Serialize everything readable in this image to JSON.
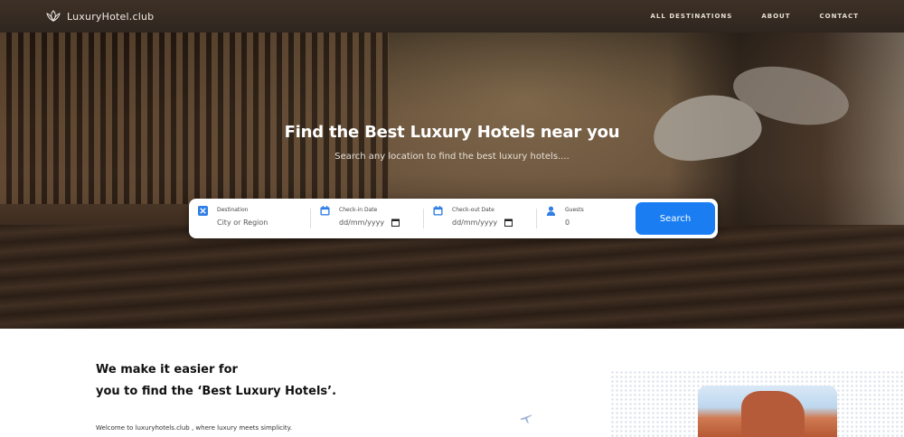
{
  "nav": {
    "logo_text": "LuxuryHotel.club",
    "logo_icon": "lotus-icon",
    "links": [
      "ALL DESTINATIONS",
      "ABOUT",
      "CONTACT"
    ]
  },
  "hero": {
    "title": "Find the Best Luxury Hotels near you",
    "subtitle": "Search any location to find the best luxury hotels...."
  },
  "search": {
    "destination_label": "Destination",
    "destination_placeholder": "City or Region",
    "checkin_label": "Check-in Date",
    "checkin_value": "dd/mm/yyyy",
    "checkout_label": "Check-out Date",
    "checkout_value": "dd/mm/yyyy",
    "guests_label": "Guests",
    "guests_value": "0",
    "button_label": "Search",
    "accent_color": "#1a7ef2"
  },
  "about": {
    "heading_line1": "We make it easier for",
    "heading_line2": "you to find the ‘Best Luxury Hotels’.",
    "paragraph": "Welcome to luxuryhotels.club , where luxury meets simplicity."
  }
}
